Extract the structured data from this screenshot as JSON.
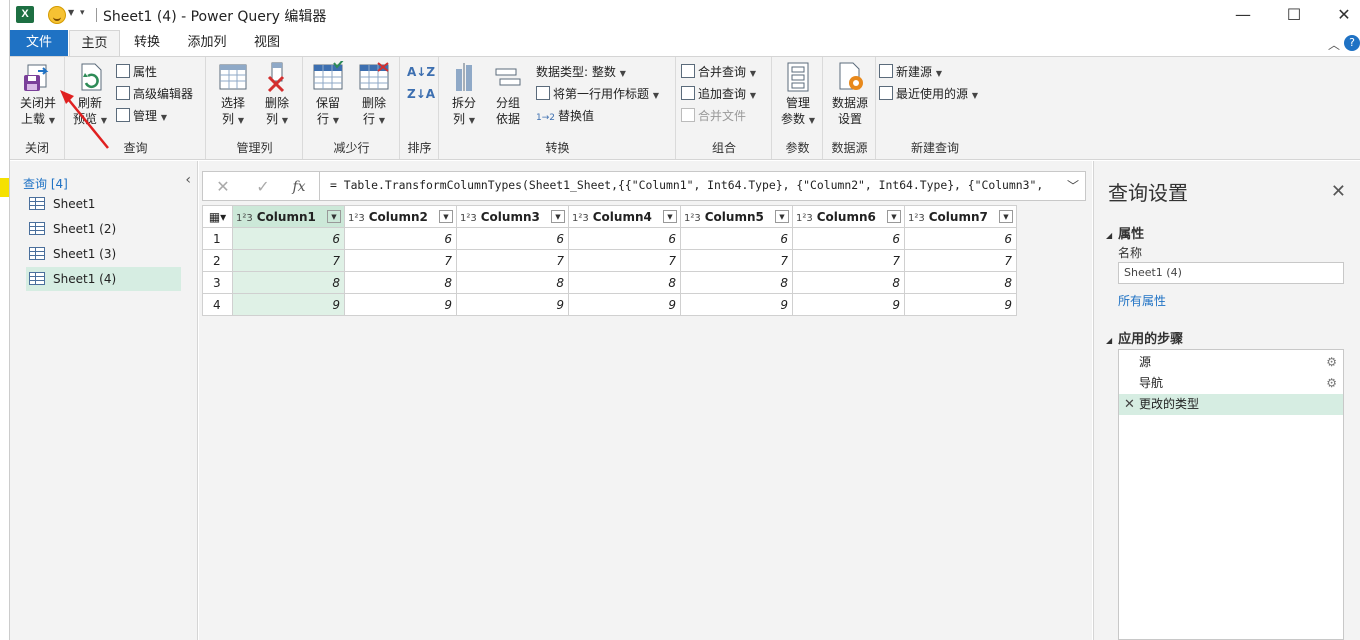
{
  "titlebar": {
    "title": "Sheet1 (4) - Power Query 编辑器",
    "excel_logo": "X",
    "minimize": "—",
    "maximize": "☐",
    "close": "✕"
  },
  "tabs": {
    "file": "文件",
    "home": "主页",
    "transform": "转换",
    "add_column": "添加列",
    "view": "视图",
    "help": "?"
  },
  "ribbon": {
    "close_group": {
      "label": "关闭",
      "close_load": "关闭并",
      "close_load2": "上载"
    },
    "query_group": {
      "label": "查询",
      "refresh": "刷新",
      "refresh2": "预览",
      "properties": "属性",
      "advanced_editor": "高级编辑器",
      "manage": "管理"
    },
    "manage_cols_group": {
      "label": "管理列",
      "choose": "选择",
      "choose2": "列",
      "remove": "删除",
      "remove2": "列"
    },
    "reduce_rows_group": {
      "label": "减少行",
      "keep": "保留",
      "keep2": "行",
      "remove": "删除",
      "remove2": "行"
    },
    "sort_group": {
      "label": "排序"
    },
    "transform_group": {
      "label": "转换",
      "split": "拆分",
      "split2": "列",
      "group_by": "分组",
      "group_by2": "依据",
      "data_type": "数据类型: 整数",
      "first_row_header": "将第一行用作标题",
      "replace_values": "替换值"
    },
    "combine_group": {
      "label": "组合",
      "merge": "合并查询",
      "append": "追加查询",
      "combine_files": "合并文件"
    },
    "params_group": {
      "label": "参数",
      "manage": "管理",
      "manage2": "参数"
    },
    "datasource_group": {
      "label": "数据源",
      "settings": "数据源",
      "settings2": "设置"
    },
    "newquery_group": {
      "label": "新建查询",
      "new_source": "新建源",
      "recent_sources": "最近使用的源"
    }
  },
  "queries": {
    "header": "查询 [4]",
    "items": [
      {
        "label": "Sheet1",
        "selected": false
      },
      {
        "label": "Sheet1 (2)",
        "selected": false
      },
      {
        "label": "Sheet1 (3)",
        "selected": false
      },
      {
        "label": "Sheet1 (4)",
        "selected": true
      }
    ]
  },
  "formula": {
    "text": "= Table.TransformColumnTypes(Sheet1_Sheet,{{\"Column1\", Int64.Type}, {\"Column2\", Int64.Type}, {\"Column3\",",
    "cancel": "✕",
    "commit": "✓",
    "fx": "fx"
  },
  "grid": {
    "type_icon": "1²3",
    "columns": [
      "Column1",
      "Column2",
      "Column3",
      "Column4",
      "Column5",
      "Column6",
      "Column7"
    ],
    "rows": [
      {
        "n": "1",
        "values": [
          "6",
          "6",
          "6",
          "6",
          "6",
          "6",
          "6"
        ]
      },
      {
        "n": "2",
        "values": [
          "7",
          "7",
          "7",
          "7",
          "7",
          "7",
          "7"
        ]
      },
      {
        "n": "3",
        "values": [
          "8",
          "8",
          "8",
          "8",
          "8",
          "8",
          "8"
        ]
      },
      {
        "n": "4",
        "values": [
          "9",
          "9",
          "9",
          "9",
          "9",
          "9",
          "9"
        ]
      }
    ]
  },
  "settings": {
    "title": "查询设置",
    "properties": "属性",
    "name_label": "名称",
    "name_value": "Sheet1 (4)",
    "all_properties": "所有属性",
    "applied_steps": "应用的步骤",
    "steps": [
      {
        "label": "源",
        "gear": true,
        "active": false
      },
      {
        "label": "导航",
        "gear": true,
        "active": false
      },
      {
        "label": "更改的类型",
        "gear": false,
        "active": true
      }
    ]
  },
  "colors": {
    "accent": "#1f72c4",
    "selection": "#d6ede2",
    "annotation_arrow": "#e02020"
  }
}
